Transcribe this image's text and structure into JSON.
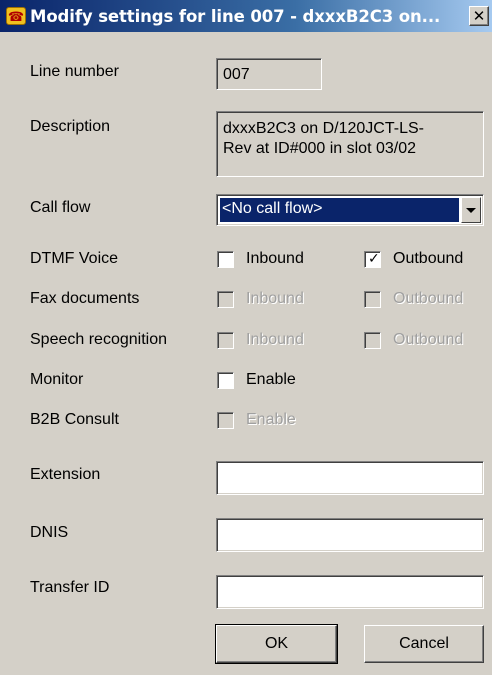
{
  "window": {
    "title": "Modify settings for line 007 - dxxxB2C3 on...",
    "close_glyph": "✕",
    "title_icon": "telephone-icon"
  },
  "line_number": {
    "label": "Line number",
    "value": "007"
  },
  "description": {
    "label": "Description",
    "line1": "dxxxB2C3 on D/120JCT-LS-",
    "line2": "Rev at ID#000 in slot 03/02"
  },
  "call_flow": {
    "label": "Call flow",
    "selected": "<No call flow>"
  },
  "dtmf_voice": {
    "label": "DTMF Voice",
    "inbound": {
      "label": "Inbound",
      "checked": false,
      "enabled": true
    },
    "outbound": {
      "label": "Outbound",
      "checked": true,
      "enabled": true
    }
  },
  "fax_documents": {
    "label": "Fax documents",
    "inbound": {
      "label": "Inbound",
      "checked": false,
      "enabled": false
    },
    "outbound": {
      "label": "Outbound",
      "checked": false,
      "enabled": false
    }
  },
  "speech_recognition": {
    "label": "Speech recognition",
    "inbound": {
      "label": "Inbound",
      "checked": false,
      "enabled": false
    },
    "outbound": {
      "label": "Outbound",
      "checked": false,
      "enabled": false
    }
  },
  "monitor": {
    "label": "Monitor",
    "enable": {
      "label": "Enable",
      "checked": false,
      "enabled": true
    }
  },
  "b2b_consult": {
    "label": "B2B Consult",
    "enable": {
      "label": "Enable",
      "checked": false,
      "enabled": false
    }
  },
  "extension": {
    "label": "Extension",
    "value": ""
  },
  "dnis": {
    "label": "DNIS",
    "value": ""
  },
  "transfer_id": {
    "label": "Transfer ID",
    "value": ""
  },
  "buttons": {
    "ok": "OK",
    "cancel": "Cancel"
  },
  "colors": {
    "title_start": "#0a246a",
    "title_end": "#a6caf0",
    "dialog_bg": "#d4d0c8",
    "selection": "#0a246a",
    "disabled_text": "#a0a0a0"
  }
}
